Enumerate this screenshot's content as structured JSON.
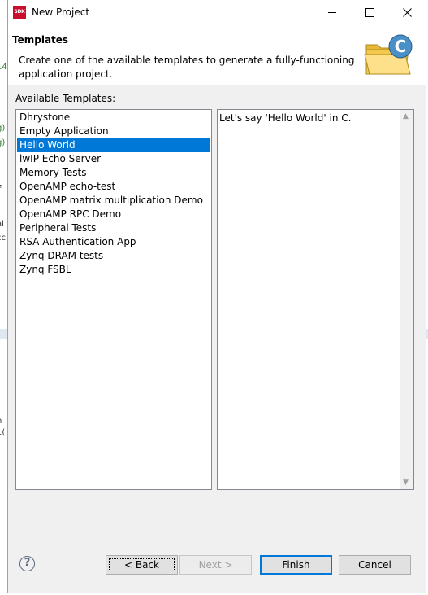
{
  "window": {
    "title": "New Project",
    "icon_text": "SDK"
  },
  "banner": {
    "title": "Templates",
    "description": "Create one of the available templates to generate a fully-functioning application project.",
    "icon_text": "C"
  },
  "templates": {
    "label": "Available Templates:",
    "items": [
      "Dhrystone",
      "Empty Application",
      "Hello World",
      "lwIP Echo Server",
      "Memory Tests",
      "OpenAMP echo-test",
      "OpenAMP matrix multiplication Demo",
      "OpenAMP RPC Demo",
      "Peripheral Tests",
      "RSA Authentication App",
      "Zynq DRAM tests",
      "Zynq FSBL"
    ],
    "selected": "Hello World",
    "description": "Let's say 'Hello World' in C."
  },
  "buttons": {
    "help": "?",
    "back": "< Back",
    "next": "Next >",
    "finish": "Finish",
    "cancel": "Cancel"
  },
  "colors": {
    "selection": "#0078d7",
    "sdk_icon": "#c8102e"
  }
}
